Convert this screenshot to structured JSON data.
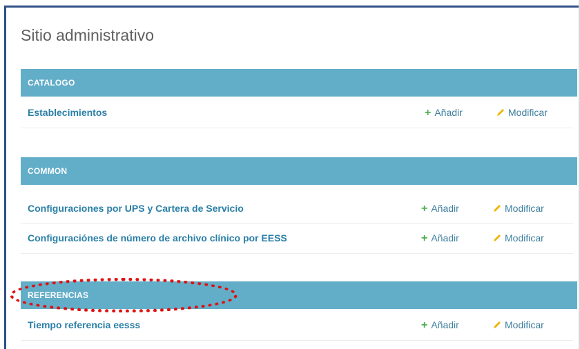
{
  "site_title": "Sitio administrativo",
  "modules": [
    {
      "header": "CATALOGO",
      "rows": [
        {
          "name": "Establecimientos",
          "add": "Añadir",
          "change": "Modificar"
        }
      ]
    },
    {
      "header": "COMMON",
      "rows": [
        {
          "name": "Configuraciones por UPS y Cartera de Servicio",
          "add": "Añadir",
          "change": "Modificar"
        },
        {
          "name": "Configuraciónes de número de archivo clínico por EESS",
          "add": "Añadir",
          "change": "Modificar"
        }
      ]
    },
    {
      "header": "REFERENCIAS",
      "rows": [
        {
          "name": "Tiempo referencia eesss",
          "add": "Añadir",
          "change": "Modificar"
        }
      ]
    }
  ],
  "icons": {
    "add": "plus-icon",
    "change": "pencil-icon"
  },
  "colors": {
    "header_bg": "#62adc8",
    "link": "#2a7fa7",
    "add_icon": "#4caf50",
    "pencil_icon": "#f0b400",
    "highlight": "#dd1111"
  }
}
